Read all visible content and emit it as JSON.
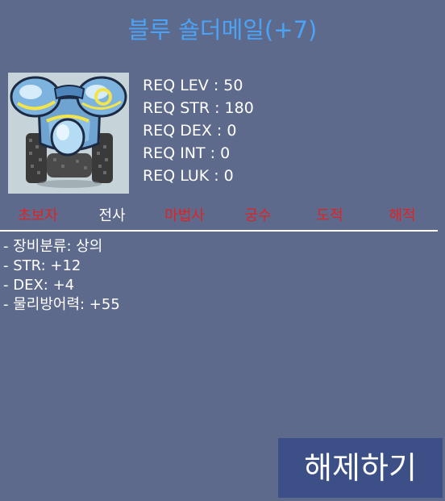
{
  "item": {
    "name": "블루 숄더메일(+7)",
    "icon": "blue-shoulder-mail-armor-icon"
  },
  "requirements": [
    "REQ LEV : 50",
    "REQ STR : 180",
    "REQ DEX : 0",
    "REQ INT : 0",
    "REQ LUK : 0"
  ],
  "jobs": [
    {
      "label": "초보자",
      "active": false
    },
    {
      "label": "전사",
      "active": true
    },
    {
      "label": "마법사",
      "active": false
    },
    {
      "label": "궁수",
      "active": false
    },
    {
      "label": "도적",
      "active": false
    },
    {
      "label": "해적",
      "active": false
    }
  ],
  "stats": [
    "- 장비분류: 상의",
    "- STR: +12",
    "- DEX: +4",
    "- 물리방어력: +55"
  ],
  "actions": {
    "unequip_label": "해제하기"
  },
  "colors": {
    "background": "#5e6a8c",
    "title": "#4aa3f7",
    "job_inactive": "#e02222",
    "job_active": "#ffffff",
    "button": "#3c4f86"
  }
}
